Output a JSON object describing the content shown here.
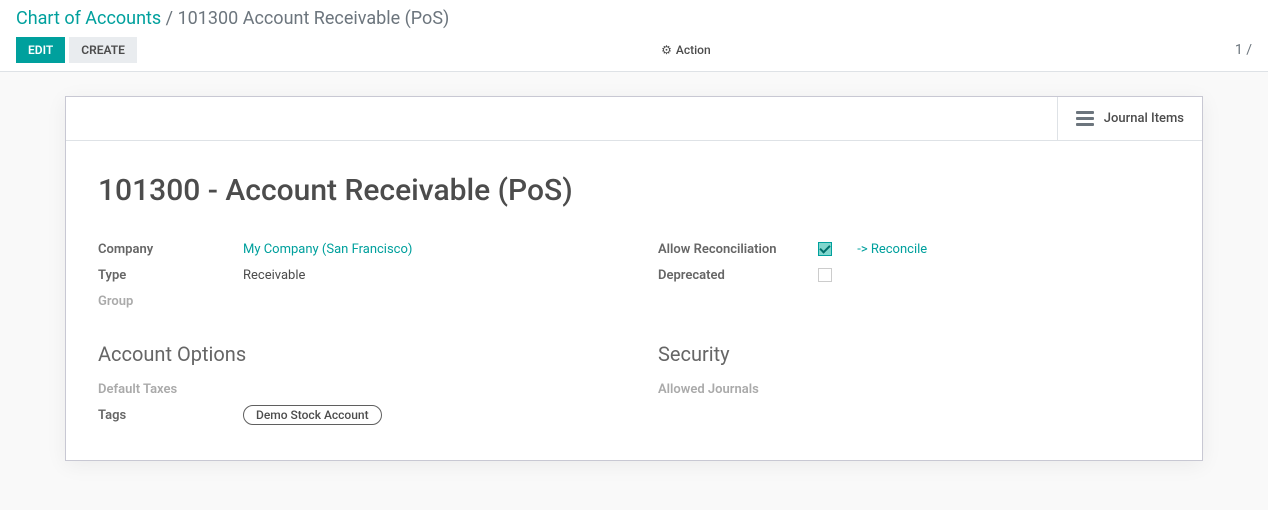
{
  "breadcrumb": {
    "root": "Chart of Accounts",
    "sep": " / ",
    "current": "101300 Account Receivable (PoS)"
  },
  "controls": {
    "edit": "EDIT",
    "create": "CREATE",
    "action": "Action",
    "pager": "1 /"
  },
  "button_box": {
    "journal_items": "Journal Items"
  },
  "record": {
    "title": "101300 - Account Receivable (PoS)",
    "labels": {
      "company": "Company",
      "type": "Type",
      "group": "Group",
      "allow_reconciliation": "Allow Reconciliation",
      "deprecated": "Deprecated",
      "default_taxes": "Default Taxes",
      "tags": "Tags",
      "allowed_journals": "Allowed Journals"
    },
    "company": "My Company (San Francisco)",
    "type": "Receivable",
    "group": "",
    "reconcile_link": "-> Reconcile",
    "sections": {
      "account_options": "Account Options",
      "security": "Security"
    },
    "tags": [
      "Demo Stock Account"
    ]
  }
}
